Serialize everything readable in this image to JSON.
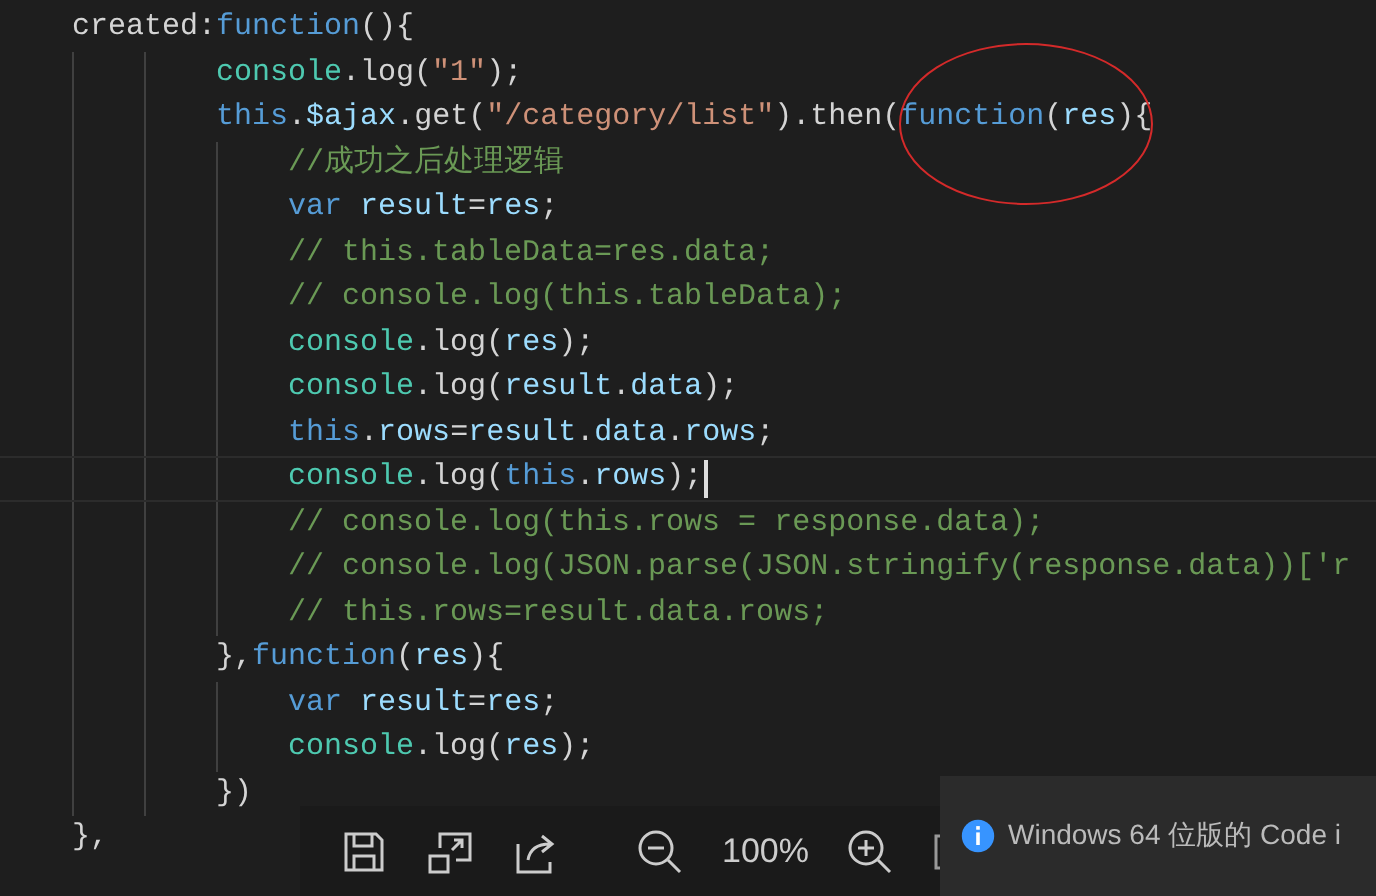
{
  "editor": {
    "lines": [
      {
        "current": false,
        "tokens": [
          {
            "kind": "plain",
            "text": "    created:"
          },
          {
            "kind": "keyword",
            "text": "function"
          },
          {
            "kind": "plain",
            "text": "(){"
          }
        ]
      },
      {
        "current": false,
        "tokens": [
          {
            "kind": "class",
            "text": "            console"
          },
          {
            "kind": "plain",
            "text": ".log("
          },
          {
            "kind": "string",
            "text": "\"1\""
          },
          {
            "kind": "plain",
            "text": ");"
          }
        ]
      },
      {
        "current": false,
        "tokens": [
          {
            "kind": "keyword",
            "text": "            this"
          },
          {
            "kind": "plain",
            "text": "."
          },
          {
            "kind": "variable",
            "text": "$ajax"
          },
          {
            "kind": "plain",
            "text": ".get("
          },
          {
            "kind": "string",
            "text": "\"/category/list\""
          },
          {
            "kind": "plain",
            "text": ").then("
          },
          {
            "kind": "keyword",
            "text": "function"
          },
          {
            "kind": "plain",
            "text": "("
          },
          {
            "kind": "variable",
            "text": "res"
          },
          {
            "kind": "plain",
            "text": "){"
          }
        ]
      },
      {
        "current": false,
        "tokens": [
          {
            "kind": "comment",
            "text": "                //成功之后处理逻辑"
          }
        ]
      },
      {
        "current": false,
        "tokens": [
          {
            "kind": "keyword",
            "text": "                var "
          },
          {
            "kind": "variable",
            "text": "result"
          },
          {
            "kind": "plain",
            "text": "="
          },
          {
            "kind": "variable",
            "text": "res"
          },
          {
            "kind": "plain",
            "text": ";"
          }
        ]
      },
      {
        "current": false,
        "tokens": [
          {
            "kind": "comment",
            "text": "                // this.tableData=res.data;"
          }
        ]
      },
      {
        "current": false,
        "tokens": [
          {
            "kind": "comment",
            "text": "                // console.log(this.tableData);"
          }
        ]
      },
      {
        "current": false,
        "tokens": [
          {
            "kind": "class",
            "text": "                console"
          },
          {
            "kind": "plain",
            "text": ".log("
          },
          {
            "kind": "variable",
            "text": "res"
          },
          {
            "kind": "plain",
            "text": ");"
          }
        ]
      },
      {
        "current": false,
        "tokens": [
          {
            "kind": "class",
            "text": "                console"
          },
          {
            "kind": "plain",
            "text": ".log("
          },
          {
            "kind": "variable",
            "text": "result"
          },
          {
            "kind": "plain",
            "text": "."
          },
          {
            "kind": "variable",
            "text": "data"
          },
          {
            "kind": "plain",
            "text": ");"
          }
        ]
      },
      {
        "current": false,
        "tokens": [
          {
            "kind": "keyword",
            "text": "                this"
          },
          {
            "kind": "plain",
            "text": "."
          },
          {
            "kind": "variable",
            "text": "rows"
          },
          {
            "kind": "plain",
            "text": "="
          },
          {
            "kind": "variable",
            "text": "result"
          },
          {
            "kind": "plain",
            "text": "."
          },
          {
            "kind": "variable",
            "text": "data"
          },
          {
            "kind": "plain",
            "text": "."
          },
          {
            "kind": "variable",
            "text": "rows"
          },
          {
            "kind": "plain",
            "text": ";"
          }
        ]
      },
      {
        "current": true,
        "tokens": [
          {
            "kind": "class",
            "text": "                console"
          },
          {
            "kind": "plain",
            "text": ".log("
          },
          {
            "kind": "keyword",
            "text": "this"
          },
          {
            "kind": "plain",
            "text": "."
          },
          {
            "kind": "variable",
            "text": "rows"
          },
          {
            "kind": "plain",
            "text": ");"
          }
        ]
      },
      {
        "current": false,
        "tokens": [
          {
            "kind": "comment",
            "text": "                // console.log(this.rows = response.data);"
          }
        ]
      },
      {
        "current": false,
        "tokens": [
          {
            "kind": "comment",
            "text": "                // console.log(JSON.parse(JSON.stringify(response.data))['r"
          }
        ]
      },
      {
        "current": false,
        "tokens": [
          {
            "kind": "comment",
            "text": "                // this.rows=result.data.rows;"
          }
        ]
      },
      {
        "current": false,
        "tokens": [
          {
            "kind": "plain",
            "text": "            },"
          },
          {
            "kind": "keyword",
            "text": "function"
          },
          {
            "kind": "plain",
            "text": "("
          },
          {
            "kind": "variable",
            "text": "res"
          },
          {
            "kind": "plain",
            "text": "){"
          }
        ]
      },
      {
        "current": false,
        "tokens": [
          {
            "kind": "keyword",
            "text": "                var "
          },
          {
            "kind": "variable",
            "text": "result"
          },
          {
            "kind": "plain",
            "text": "="
          },
          {
            "kind": "variable",
            "text": "res"
          },
          {
            "kind": "plain",
            "text": ";"
          }
        ]
      },
      {
        "current": false,
        "tokens": [
          {
            "kind": "class",
            "text": "                console"
          },
          {
            "kind": "plain",
            "text": ".log("
          },
          {
            "kind": "variable",
            "text": "res"
          },
          {
            "kind": "plain",
            "text": ");"
          }
        ]
      },
      {
        "current": false,
        "tokens": [
          {
            "kind": "plain",
            "text": "            })"
          }
        ]
      },
      {
        "current": false,
        "tokens": [
          {
            "kind": "plain",
            "text": "    },"
          }
        ]
      }
    ]
  },
  "viewer_toolbar": {
    "buttons": [
      {
        "kind": "save"
      },
      {
        "kind": "resize"
      },
      {
        "kind": "share"
      },
      {
        "kind": "divider"
      },
      {
        "kind": "zoom-out"
      },
      {
        "kind": "zoom-level",
        "text": "100%"
      },
      {
        "kind": "zoom-in"
      },
      {
        "kind": "fit"
      }
    ]
  },
  "notification": {
    "text": "Windows 64 位版的 Code i"
  }
}
